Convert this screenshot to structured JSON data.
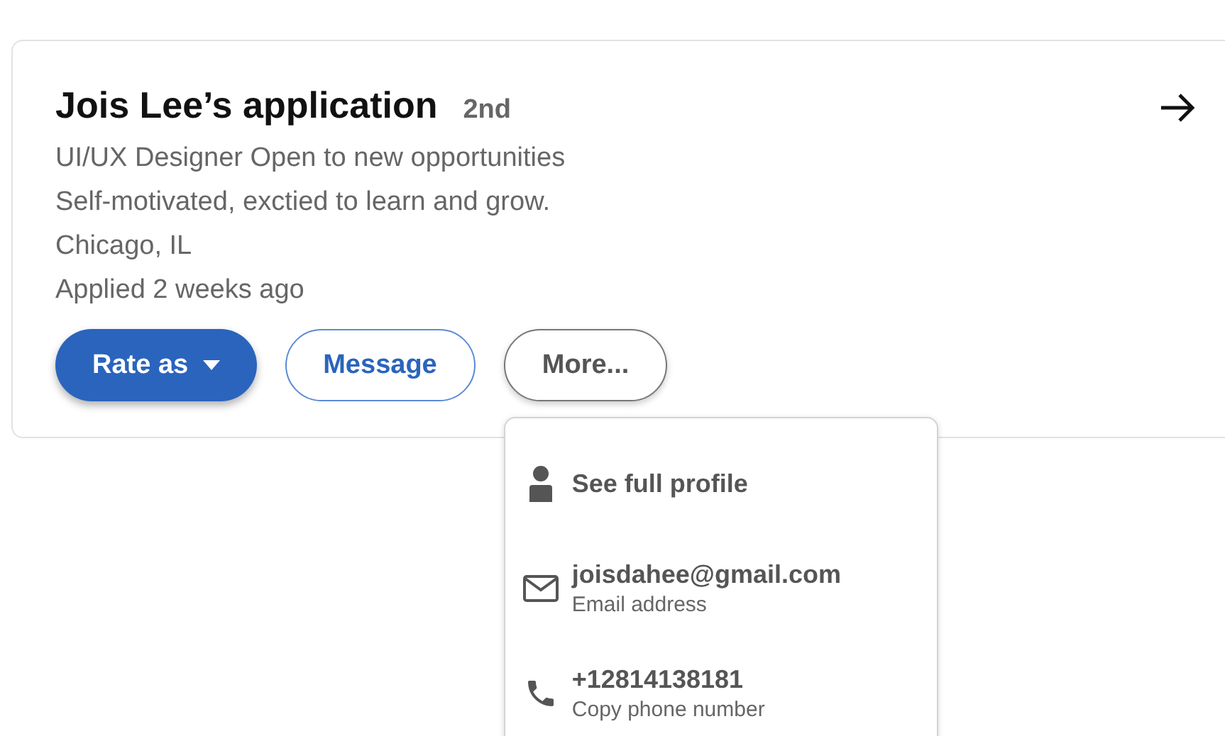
{
  "card": {
    "title": "Jois Lee’s application",
    "degree": "2nd",
    "lines": [
      "UI/UX Designer Open to new opportunities",
      "Self-motivated, exctied to learn and grow.",
      "Chicago, IL",
      "Applied 2 weeks ago"
    ],
    "buttons": [
      {
        "label": "Rate as",
        "kind": "primary"
      },
      {
        "label": "Message",
        "kind": "outline"
      },
      {
        "label": "More...",
        "kind": "neutral",
        "expanded": true
      }
    ]
  },
  "menu": {
    "items": [
      {
        "kind": "profile",
        "label": "See full profile"
      },
      {
        "kind": "email",
        "label": "joisdahee@gmail.com",
        "caption": "Email address"
      },
      {
        "kind": "phone",
        "label": "+12814138181",
        "caption": "Copy phone number"
      }
    ]
  }
}
